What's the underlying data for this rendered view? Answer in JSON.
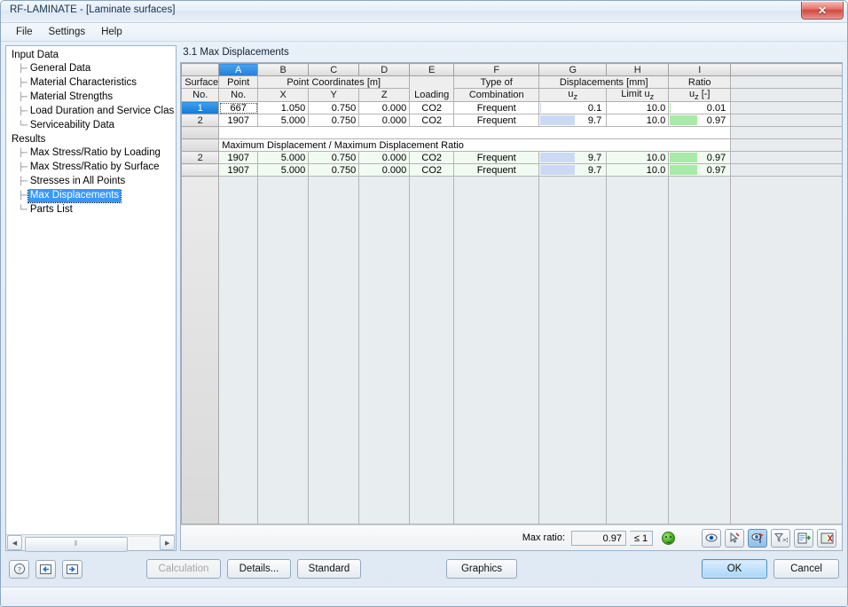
{
  "window": {
    "title": "RF-LAMINATE - [Laminate surfaces]",
    "close_label": "✕"
  },
  "menubar": {
    "items": [
      {
        "label": "File"
      },
      {
        "label": "Settings"
      },
      {
        "label": "Help"
      }
    ]
  },
  "sidebar": {
    "groups": [
      {
        "label": "Input Data",
        "items": [
          {
            "label": "General Data",
            "selected": false
          },
          {
            "label": "Material Characteristics",
            "selected": false
          },
          {
            "label": "Material Strengths",
            "selected": false
          },
          {
            "label": "Load Duration and Service Clas",
            "selected": false
          },
          {
            "label": "Serviceability Data",
            "selected": false
          }
        ]
      },
      {
        "label": "Results",
        "items": [
          {
            "label": "Max Stress/Ratio by Loading",
            "selected": false
          },
          {
            "label": "Max Stress/Ratio by Surface",
            "selected": false
          },
          {
            "label": "Stresses in All Points",
            "selected": false
          },
          {
            "label": "Max Displacements",
            "selected": true
          },
          {
            "label": "Parts List",
            "selected": false
          }
        ]
      }
    ],
    "scrollbar": {
      "left_arrow": "◀",
      "right_arrow": "▶",
      "grip": "⦀"
    }
  },
  "main": {
    "panel_title": "3.1 Max Displacements",
    "table": {
      "column_letters": [
        "",
        "A",
        "B",
        "C",
        "D",
        "E",
        "F",
        "G",
        "H",
        "I",
        ""
      ],
      "active_column_letter": "A",
      "header_group_row": [
        "Surface",
        "Point",
        "Point Coordinates [m]",
        "Loading",
        "Type of",
        "Displacements [mm]",
        "Ratio"
      ],
      "headers": {
        "surface_top": "Surface",
        "surface_bottom": "No.",
        "point_top": "Point",
        "point_bottom": "No.",
        "coords_group": "Point Coordinates [m]",
        "coord_x": "X",
        "coord_y": "Y",
        "coord_z": "Z",
        "loading": "Loading",
        "comb_top": "Type of",
        "comb_bottom": "Combination",
        "disp_group": "Displacements [mm]",
        "disp_uz": "u",
        "disp_uz_sub": "z",
        "limit_label": "Limit u",
        "limit_sub": "z",
        "ratio_group": "Ratio",
        "ratio_uz": "u",
        "ratio_uz_sub": "z",
        "ratio_unit": " [-]"
      },
      "rows": [
        {
          "row_no": "1",
          "selected": true,
          "focused_cell": "point_no",
          "point_no": "667",
          "x": "1.050",
          "y": "0.750",
          "z": "0.000",
          "loading": "CO2",
          "combination": "Frequent",
          "uz": "0.1",
          "uz_bar_pct": 1,
          "limit_uz": "10.0",
          "ratio": "0.01",
          "ratio_bar_pct": 1,
          "green": false
        },
        {
          "row_no": "2",
          "selected": false,
          "point_no": "1907",
          "x": "5.000",
          "y": "0.750",
          "z": "0.000",
          "loading": "CO2",
          "combination": "Frequent",
          "uz": "9.7",
          "uz_bar_pct": 52,
          "limit_uz": "10.0",
          "ratio": "0.97",
          "ratio_bar_pct": 45,
          "green": false
        }
      ],
      "section_title": "Maximum Displacement / Maximum Displacement Ratio",
      "summary_rows": [
        {
          "row_no": "2",
          "point_no": "1907",
          "x": "5.000",
          "y": "0.750",
          "z": "0.000",
          "loading": "CO2",
          "combination": "Frequent",
          "uz": "9.7",
          "uz_bar_pct": 52,
          "limit_uz": "10.0",
          "ratio": "0.97",
          "ratio_bar_pct": 45,
          "green": true
        },
        {
          "row_no": "",
          "point_no": "1907",
          "x": "5.000",
          "y": "0.750",
          "z": "0.000",
          "loading": "CO2",
          "combination": "Frequent",
          "uz": "9.7",
          "uz_bar_pct": 52,
          "limit_uz": "10.0",
          "ratio": "0.97",
          "ratio_bar_pct": 45,
          "green": true
        }
      ]
    },
    "footer": {
      "max_ratio_label": "Max ratio:",
      "max_ratio_value": "0.97",
      "condition": "≤ 1",
      "status_icon": "smiley-green-icon",
      "tools": [
        {
          "name": "view-results-icon",
          "active": false
        },
        {
          "name": "select-pointer-icon",
          "active": false
        },
        {
          "name": "view-flag-icon",
          "active": true
        },
        {
          "name": "filter-greater-one-icon",
          "active": false
        },
        {
          "name": "printout-report-icon",
          "active": false
        },
        {
          "name": "excel-export-icon",
          "active": false
        }
      ]
    }
  },
  "bottombar": {
    "icon_buttons": [
      {
        "name": "help-icon",
        "glyph": "?"
      },
      {
        "name": "previous-page-icon",
        "glyph": "◀"
      },
      {
        "name": "next-page-icon",
        "glyph": "▶"
      }
    ],
    "buttons": [
      {
        "label": "Calculation",
        "disabled": true
      },
      {
        "label": "Details...",
        "disabled": false
      },
      {
        "label": "Standard",
        "disabled": false
      },
      {
        "label": "Graphics",
        "disabled": false
      }
    ],
    "ok_label": "OK",
    "cancel_label": "Cancel"
  },
  "colors": {
    "accent": "#1f7fd8",
    "bar_blue": "#ccd9f5",
    "bar_green": "#a8eaa8",
    "summary_row_bg": "#f1fbf1",
    "close_red": "#cf4a42"
  }
}
